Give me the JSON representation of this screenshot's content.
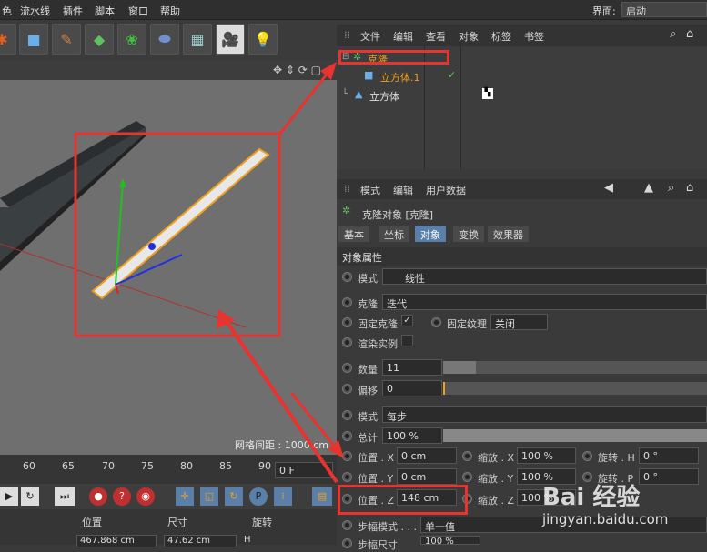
{
  "menubar": {
    "items": [
      "色",
      "流水线",
      "插件",
      "脚本",
      "窗口",
      "帮助"
    ],
    "layout_label": "界面:",
    "layout_value": "启动"
  },
  "object_manager": {
    "menu": [
      "文件",
      "编辑",
      "查看",
      "对象",
      "标签",
      "书签"
    ],
    "objects": [
      {
        "name": "克隆"
      },
      {
        "name": "立方体.1"
      },
      {
        "name": "立方体"
      }
    ]
  },
  "attribute_manager": {
    "menu": [
      "模式",
      "编辑",
      "用户数据"
    ],
    "title": "克隆对象 [克隆]",
    "tabs": [
      "基本",
      "坐标",
      "对象",
      "变换",
      "效果器"
    ],
    "section": "对象属性",
    "mode_label": "模式",
    "mode_value": "线性",
    "clones_label": "克隆",
    "clones_value": "迭代",
    "fix_clone_label": "固定克隆",
    "fix_texture_label": "固定纹理",
    "fix_texture_value": "关闭",
    "render_instances_label": "渲染实例",
    "count_label": "数量",
    "count_value": "11",
    "offset_label": "偏移",
    "offset_value": "0",
    "mode2_label": "模式",
    "mode2_value": "每步",
    "total_label": "总计",
    "total_value": "100 %",
    "pos_x_label": "位置 . X",
    "pos_x_value": "0 cm",
    "scale_x_label": "缩放 . X",
    "scale_x_value": "100 %",
    "rot_h_label": "旋转 . H",
    "rot_h_value": "0 °",
    "pos_y_label": "位置 . Y",
    "pos_y_value": "0 cm",
    "scale_y_label": "缩放 . Y",
    "scale_y_value": "100 %",
    "rot_p_label": "旋转 . P",
    "rot_p_value": "0 °",
    "pos_z_label": "位置 . Z",
    "pos_z_value": "148 cm",
    "scale_z_label": "缩放 . Z",
    "scale_z_value": "100 %",
    "step_mode_label": "步幅模式 . . .",
    "step_mode_value": "单一值",
    "step_size_label": "步幅尺寸",
    "step_size_value": "100 %"
  },
  "viewport": {
    "grid_label": "网格间距 : 1000 cm"
  },
  "timeline": {
    "ticks": [
      "60",
      "65",
      "70",
      "75",
      "80",
      "85",
      "90"
    ],
    "frame_value": "0 F",
    "coord_headers": [
      "位置",
      "尺寸",
      "旋转"
    ],
    "coord_x_value": "467.868 cm",
    "size_x_value": "47.62 cm",
    "rot_label": "H"
  },
  "watermark": {
    "brand": "Bai 经验",
    "url": "jingyan.baidu.com"
  },
  "colors": {
    "accent": "#5a7fa8",
    "highlight": "#e8332f",
    "selected": "#f0a020"
  }
}
